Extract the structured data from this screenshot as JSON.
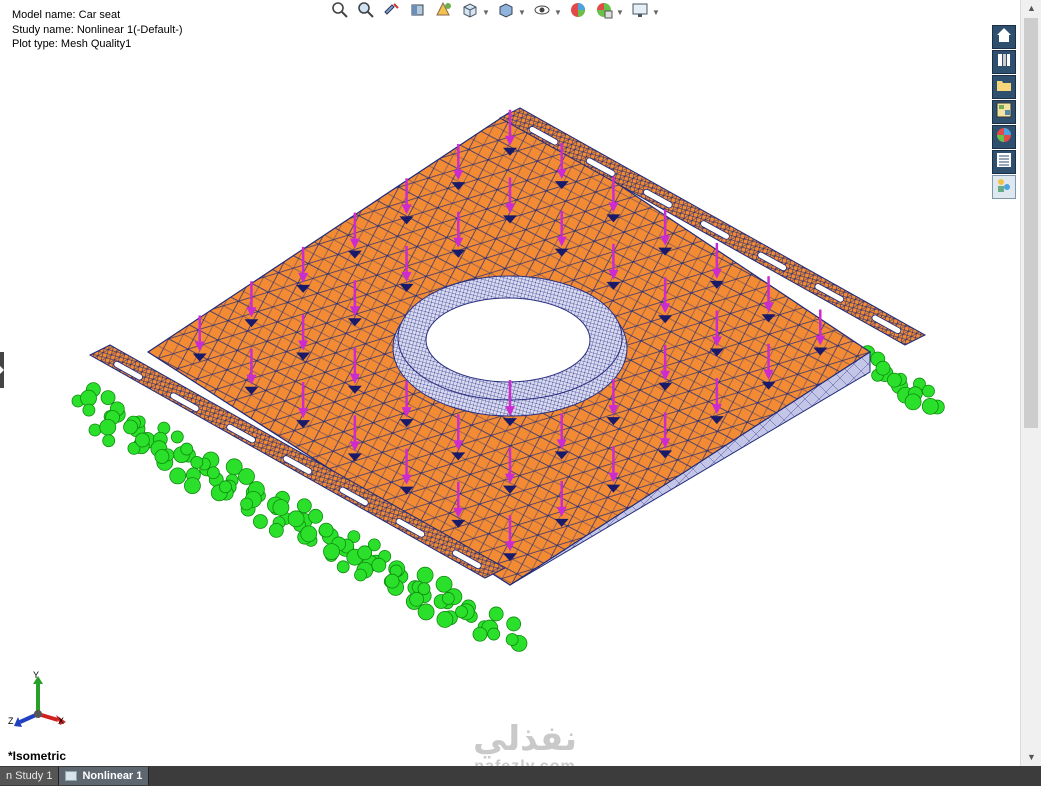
{
  "info": {
    "model_name": "Model name: Car seat",
    "study_name": "Study name: Nonlinear 1(-Default-)",
    "plot_type": "Plot type: Mesh Quality1"
  },
  "view_label": "*Isometric",
  "toolbar": {
    "items": [
      {
        "icon": "zoom-to-fit-icon",
        "has_dropdown": false
      },
      {
        "icon": "zoom-to-area-icon",
        "has_dropdown": false
      },
      {
        "icon": "previous-view-icon",
        "has_dropdown": false
      },
      {
        "icon": "section-view-icon",
        "has_dropdown": false
      },
      {
        "icon": "dynamic-annotation-icon",
        "has_dropdown": false
      },
      {
        "icon": "view-orientation-icon",
        "has_dropdown": true
      },
      {
        "icon": "display-style-icon",
        "has_dropdown": true
      },
      {
        "icon": "hide-show-items-icon",
        "has_dropdown": true
      },
      {
        "icon": "edit-appearance-icon",
        "has_dropdown": false
      },
      {
        "icon": "apply-scene-icon",
        "has_dropdown": true
      },
      {
        "icon": "view-settings-icon",
        "has_dropdown": true
      }
    ]
  },
  "task_pane": [
    "home-icon",
    "design-library-icon",
    "file-explorer-icon",
    "view-palette-icon",
    "appearances-icon",
    "custom-properties-icon",
    "forum-icon"
  ],
  "tabs": [
    {
      "label": "n Study 1",
      "active": false
    },
    {
      "label": "Nonlinear 1",
      "active": true
    }
  ],
  "triad": {
    "y": "Y",
    "z": "Z",
    "x": "X"
  },
  "watermark": {
    "arabic": "نفذلي",
    "latin": "nafezly.com"
  },
  "colors": {
    "plate": "#f28b34",
    "mesh": "#1f2a7a",
    "rim": "#c9cbe8",
    "load_arrow": "#cc2bd0",
    "fixture": "#2be02b",
    "tab_active": "#5e6670"
  }
}
